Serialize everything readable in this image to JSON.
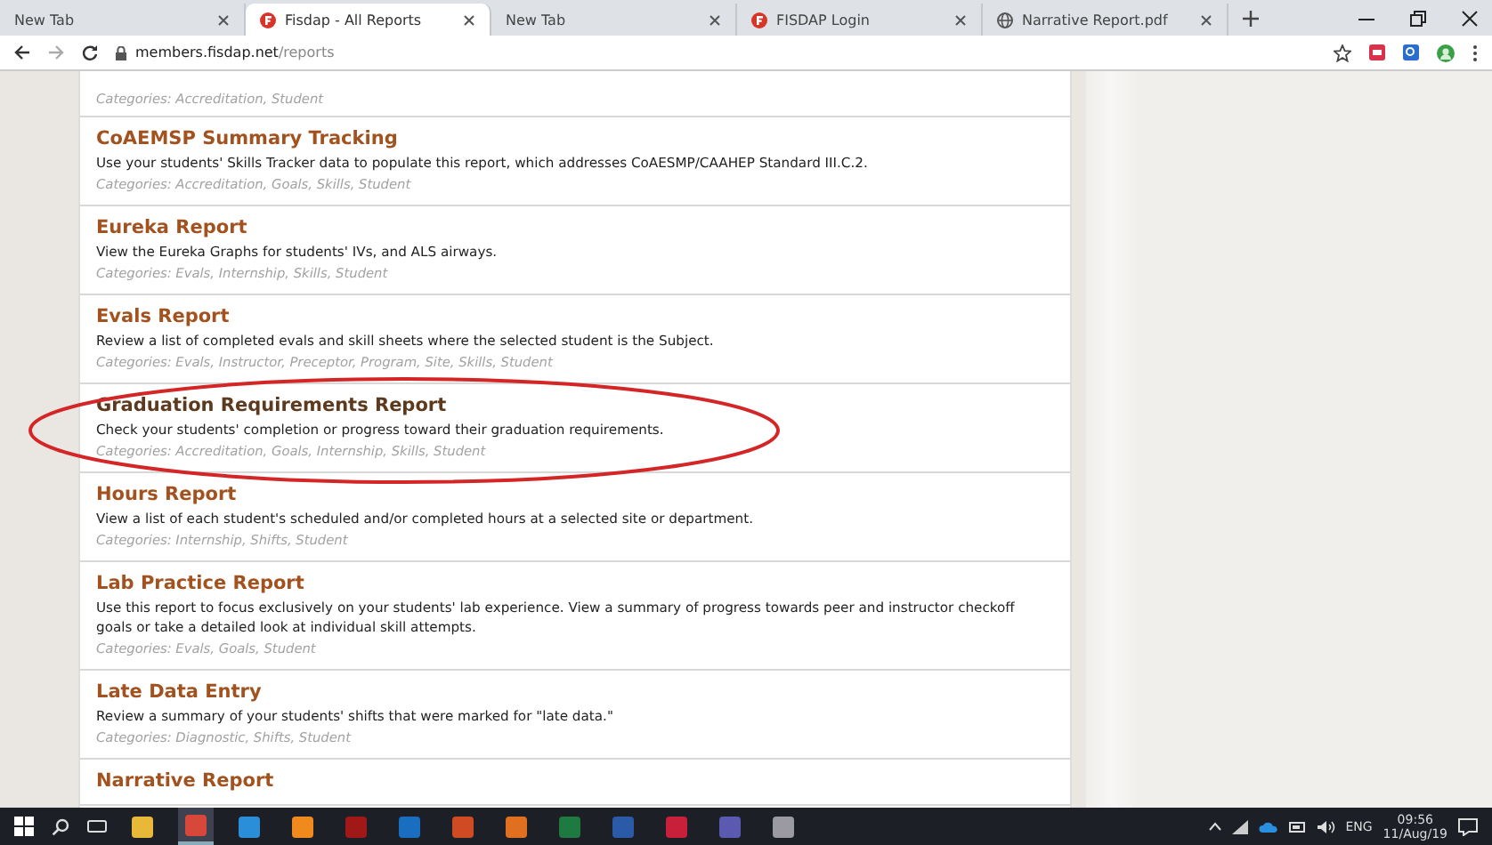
{
  "browser": {
    "tabs": [
      {
        "title": "New Tab",
        "kind": "blank",
        "selected": false
      },
      {
        "title": "Fisdap - All Reports",
        "kind": "site",
        "selected": true
      },
      {
        "title": "New Tab",
        "kind": "blank",
        "selected": false
      },
      {
        "title": "FISDAP Login",
        "kind": "site",
        "selected": false
      },
      {
        "title": "Narrative Report.pdf",
        "kind": "file",
        "selected": false
      }
    ],
    "url_host": "members.fisdap.net",
    "url_path": "/reports"
  },
  "reports": {
    "partial_categories": "Categories: Accreditation, Student",
    "items": [
      {
        "title": "CoAEMSP Summary Tracking",
        "description": "Use your students' Skills Tracker data to populate this report, which addresses CoAESMP/CAAHEP Standard III.C.2.",
        "categories": "Categories: Accreditation, Goals, Skills, Student",
        "circled": false
      },
      {
        "title": "Eureka Report",
        "description": "View the Eureka Graphs for students' IVs, and ALS airways.",
        "categories": "Categories: Evals, Internship, Skills, Student",
        "circled": false
      },
      {
        "title": "Evals Report",
        "description": "Review a list of completed evals and skill sheets where the selected student is the Subject.",
        "categories": "Categories: Evals, Instructor, Preceptor, Program, Site, Skills, Student",
        "circled": false
      },
      {
        "title": "Graduation Requirements Report",
        "description": "Check your students' completion or progress toward their graduation requirements.",
        "categories": "Categories: Accreditation, Goals, Internship, Skills, Student",
        "circled": true
      },
      {
        "title": "Hours Report",
        "description": "View a list of each student's scheduled and/or completed hours at a selected site or department.",
        "categories": "Categories: Internship, Shifts, Student",
        "circled": false
      },
      {
        "title": "Lab Practice Report",
        "description": "Use this report to focus exclusively on your students' lab experience. View a summary of progress towards peer and instructor checkoff goals or take a detailed look at individual skill attempts.",
        "categories": "Categories: Evals, Goals, Student",
        "circled": false
      },
      {
        "title": "Late Data Entry",
        "description": "Review a summary of your students' shifts that were marked for \"late data.\"",
        "categories": "Categories: Diagnostic, Shifts, Student",
        "circled": false
      },
      {
        "title": "Narrative Report",
        "circled": false
      }
    ]
  },
  "taskbar": {
    "apps": [
      {
        "color": "#e8b838",
        "active": false
      },
      {
        "color": "#d8483a",
        "active": true
      },
      {
        "color": "#2a8fd8",
        "active": false
      },
      {
        "color": "#f08a1c",
        "active": false
      },
      {
        "color": "#a01818",
        "active": false
      },
      {
        "color": "#1a6ec0",
        "active": false
      },
      {
        "color": "#d04a24",
        "active": false
      },
      {
        "color": "#e07020",
        "active": false
      },
      {
        "color": "#1e7a40",
        "active": false
      },
      {
        "color": "#2a5aa8",
        "active": false
      },
      {
        "color": "#c8203a",
        "active": false
      },
      {
        "color": "#5a5ab0",
        "active": false
      },
      {
        "color": "#9a9aa0",
        "active": false
      }
    ],
    "language": "ENG",
    "time": "09:56",
    "date": "11/Aug/19"
  }
}
